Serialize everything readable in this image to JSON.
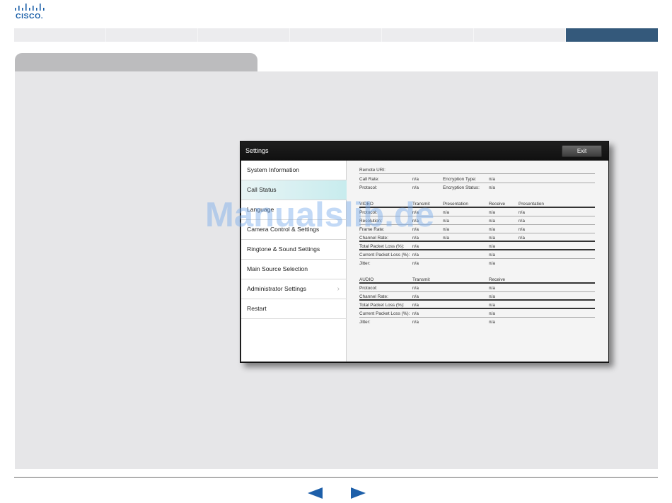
{
  "brand": {
    "logo_text": "CISCO."
  },
  "colors": {
    "brand_blue": "#1d5fa9",
    "nav_active": "#34597b",
    "panel_bg": "#e6e6e8",
    "tab_bg": "#bcbcbe"
  },
  "window": {
    "title": "Settings",
    "exit_label": "Exit"
  },
  "menu": {
    "items": [
      {
        "label": "System Information"
      },
      {
        "label": "Call Status"
      },
      {
        "label": "Language"
      },
      {
        "label": "Camera Control & Settings"
      },
      {
        "label": "Ringtone & Sound Settings"
      },
      {
        "label": "Main Source Selection"
      },
      {
        "label": "Administrator Settings"
      },
      {
        "label": "Restart"
      }
    ],
    "selected": "Call Status",
    "chevron_icon": "chevron-right-icon"
  },
  "call_status": {
    "remote_uri_label": "Remote URI:",
    "call_rate_label": "Call Rate:",
    "call_rate_value": "n/a",
    "encryption_type_label": "Encryption Type:",
    "encryption_type_value": "n/a",
    "protocol_label": "Protocol:",
    "protocol_value": "n/a",
    "encryption_status_label": "Encryption Status:",
    "encryption_status_value": "n/a",
    "video": {
      "header": "VIDEO",
      "col_transmit": "Transmit",
      "col_presentation": "Presentation",
      "col_receive": "Receive",
      "col_presentation2": "Presentation",
      "rows": [
        {
          "label": "Protocol:",
          "v": [
            "n/a",
            "n/a",
            "n/a",
            "n/a"
          ]
        },
        {
          "label": "Resolution:",
          "v": [
            "n/a",
            "n/a",
            "n/a",
            "n/a"
          ]
        },
        {
          "label": "Frame Rate:",
          "v": [
            "n/a",
            "n/a",
            "n/a",
            "n/a"
          ]
        },
        {
          "label": "Channel Rate:",
          "v": [
            "n/a",
            "n/a",
            "n/a",
            "n/a"
          ]
        },
        {
          "label": "Total Packet Loss (%):",
          "v": [
            "n/a",
            "",
            "n/a",
            ""
          ]
        },
        {
          "label": "Current Packet Loss (%):",
          "v": [
            "n/a",
            "",
            "n/a",
            ""
          ]
        },
        {
          "label": "Jitter:",
          "v": [
            "n/a",
            "",
            "n/a",
            ""
          ]
        }
      ]
    },
    "audio": {
      "header": "AUDIO",
      "col_transmit": "Transmit",
      "col_receive": "Receive",
      "rows": [
        {
          "label": "Protocol:",
          "v": [
            "n/a",
            "n/a"
          ]
        },
        {
          "label": "Channel Rate:",
          "v": [
            "n/a",
            "n/a"
          ]
        },
        {
          "label": "Total Packet Loss (%):",
          "v": [
            "n/a",
            "n/a"
          ]
        },
        {
          "label": "Current Packet Loss (%):",
          "v": [
            "n/a",
            "n/a"
          ]
        },
        {
          "label": "Jitter:",
          "v": [
            "n/a",
            "n/a"
          ]
        }
      ]
    }
  },
  "watermark": "Manualslib.de",
  "nav": {
    "prev_icon": "arrow-left-icon",
    "next_icon": "arrow-right-icon"
  }
}
